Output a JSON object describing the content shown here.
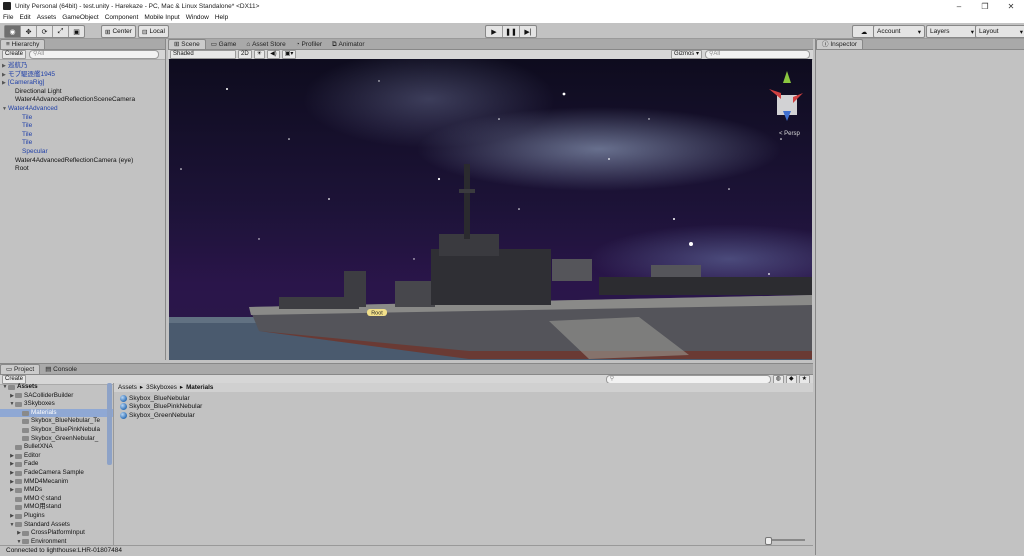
{
  "window": {
    "title": "Unity Personal (64bit) - test.unity - Harekaze - PC, Mac & Linux Standalone* <DX11>",
    "controls": [
      "–",
      "❐",
      "✕"
    ]
  },
  "menu": [
    "File",
    "Edit",
    "Assets",
    "GameObject",
    "Component",
    "Mobile Input",
    "Window",
    "Help"
  ],
  "toolbar": {
    "pivot": "Center",
    "space": "Local",
    "account": "Account",
    "layers": "Layers",
    "layout": "Layout"
  },
  "hierarchy": {
    "tab": "Hierarchy",
    "create": "Create",
    "search_placeholder": "All",
    "items": [
      {
        "label": "巡航乃",
        "blue": true,
        "indent": 0,
        "arrow": "▶"
      },
      {
        "label": "モブ駆逐艦1945",
        "blue": true,
        "indent": 0,
        "arrow": "▶"
      },
      {
        "label": "[CameraRig]",
        "blue": true,
        "indent": 0,
        "arrow": "▶"
      },
      {
        "label": "Directional Light",
        "blue": false,
        "indent": 1,
        "arrow": ""
      },
      {
        "label": "Water4AdvancedReflectionSceneCamera",
        "blue": false,
        "indent": 1,
        "arrow": ""
      },
      {
        "label": "Water4Advanced",
        "blue": true,
        "indent": 0,
        "arrow": "▼"
      },
      {
        "label": "Tile",
        "blue": true,
        "indent": 2,
        "arrow": ""
      },
      {
        "label": "Tile",
        "blue": true,
        "indent": 2,
        "arrow": ""
      },
      {
        "label": "Tile",
        "blue": true,
        "indent": 2,
        "arrow": ""
      },
      {
        "label": "Tile",
        "blue": true,
        "indent": 2,
        "arrow": ""
      },
      {
        "label": "Specular",
        "blue": true,
        "indent": 2,
        "arrow": ""
      },
      {
        "label": "Water4AdvancedReflectionCamera (eye)",
        "blue": false,
        "indent": 1,
        "arrow": ""
      },
      {
        "label": "Root",
        "blue": false,
        "indent": 1,
        "arrow": ""
      }
    ]
  },
  "scene": {
    "tabs": [
      "Scene",
      "Game",
      "Asset Store",
      "Profiler",
      "Animator"
    ],
    "shading": "Shaded",
    "mode_2d": "2D",
    "gizmos": "Gizmos",
    "search_placeholder": "All",
    "persp": "< Persp",
    "root_label": "Root"
  },
  "inspector": {
    "tab": "Inspector"
  },
  "project": {
    "tabs": [
      "Project",
      "Console"
    ],
    "create": "Create",
    "breadcrumb": [
      "Assets",
      "3Skyboxes",
      "Materials"
    ],
    "tree": [
      {
        "label": "Assets",
        "indent": 0,
        "arrow": "▼",
        "bold": true
      },
      {
        "label": "SAColliderBuilder",
        "indent": 1,
        "arrow": "▶"
      },
      {
        "label": "3Skyboxes",
        "indent": 1,
        "arrow": "▼"
      },
      {
        "label": "Materials",
        "indent": 2,
        "arrow": "",
        "selected": true
      },
      {
        "label": "Skybox_BlueNebular_Te",
        "indent": 2,
        "arrow": ""
      },
      {
        "label": "Skybox_BluePinkNebula",
        "indent": 2,
        "arrow": ""
      },
      {
        "label": "Skybox_GreenNebular_",
        "indent": 2,
        "arrow": ""
      },
      {
        "label": "BulletXNA",
        "indent": 1,
        "arrow": ""
      },
      {
        "label": "Editor",
        "indent": 1,
        "arrow": "▶"
      },
      {
        "label": "Fade",
        "indent": 1,
        "arrow": "▶"
      },
      {
        "label": "FadeCamera Sample",
        "indent": 1,
        "arrow": "▶"
      },
      {
        "label": "MMD4Mecanim",
        "indent": 1,
        "arrow": "▶"
      },
      {
        "label": "MMDs",
        "indent": 1,
        "arrow": "▶"
      },
      {
        "label": "MMOぐstand",
        "indent": 1,
        "arrow": ""
      },
      {
        "label": "MMO用stand",
        "indent": 1,
        "arrow": ""
      },
      {
        "label": "Plugins",
        "indent": 1,
        "arrow": "▶"
      },
      {
        "label": "Standard Assets",
        "indent": 1,
        "arrow": "▼"
      },
      {
        "label": "CrossPlatformInput",
        "indent": 2,
        "arrow": "▶"
      },
      {
        "label": "Environment",
        "indent": 2,
        "arrow": "▼"
      }
    ],
    "files": [
      "Skybox_BlueNebular",
      "Skybox_BluePinkNebular",
      "Skybox_GreenNebular"
    ]
  },
  "status": "Connected to lighthouse:LHR-01807484",
  "colors": {
    "accent_blue": "#1f3fa8",
    "selection": "#8fa8d4",
    "panel": "#c2c2c2"
  }
}
